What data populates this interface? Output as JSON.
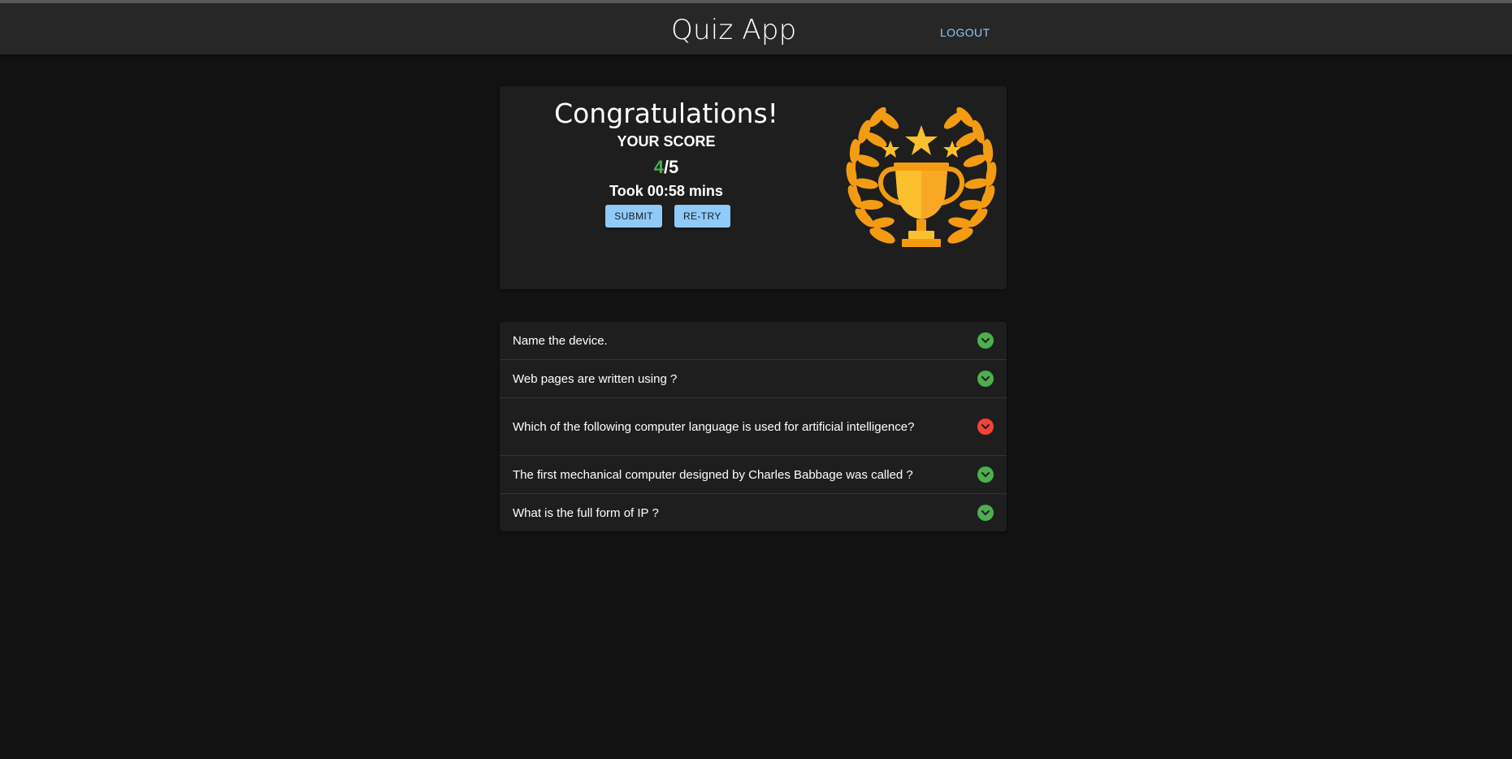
{
  "header": {
    "title": "Quiz App",
    "logout_label": "LOGOUT"
  },
  "result": {
    "heading": "Congratulations!",
    "score_label": "YOUR SCORE",
    "score_correct": "4",
    "score_total": "/5",
    "time_text": "Took 00:58 mins",
    "submit_label": "SUBMIT",
    "retry_label": "RE-TRY"
  },
  "questions": [
    {
      "text": "Name the device.",
      "status": "correct"
    },
    {
      "text": "Web pages are written using ?",
      "status": "correct"
    },
    {
      "text": "Which of the following computer language is used for artificial intelligence?",
      "status": "incorrect"
    },
    {
      "text": "The first mechanical computer designed by Charles Babbage was called ?",
      "status": "correct"
    },
    {
      "text": "What is the full form of IP ?",
      "status": "correct"
    }
  ],
  "colors": {
    "background": "#121212",
    "appbar": "#272727",
    "card": "#1e1e1e",
    "accent": "#90caf9",
    "correct": "#4caf50",
    "incorrect": "#f44336",
    "trophy_gold": "#fbc02d",
    "laurel_orange": "#f39c12"
  },
  "icons": {
    "correct": "chevron-down-icon",
    "incorrect": "chevron-down-icon",
    "trophy": "trophy-icon"
  }
}
